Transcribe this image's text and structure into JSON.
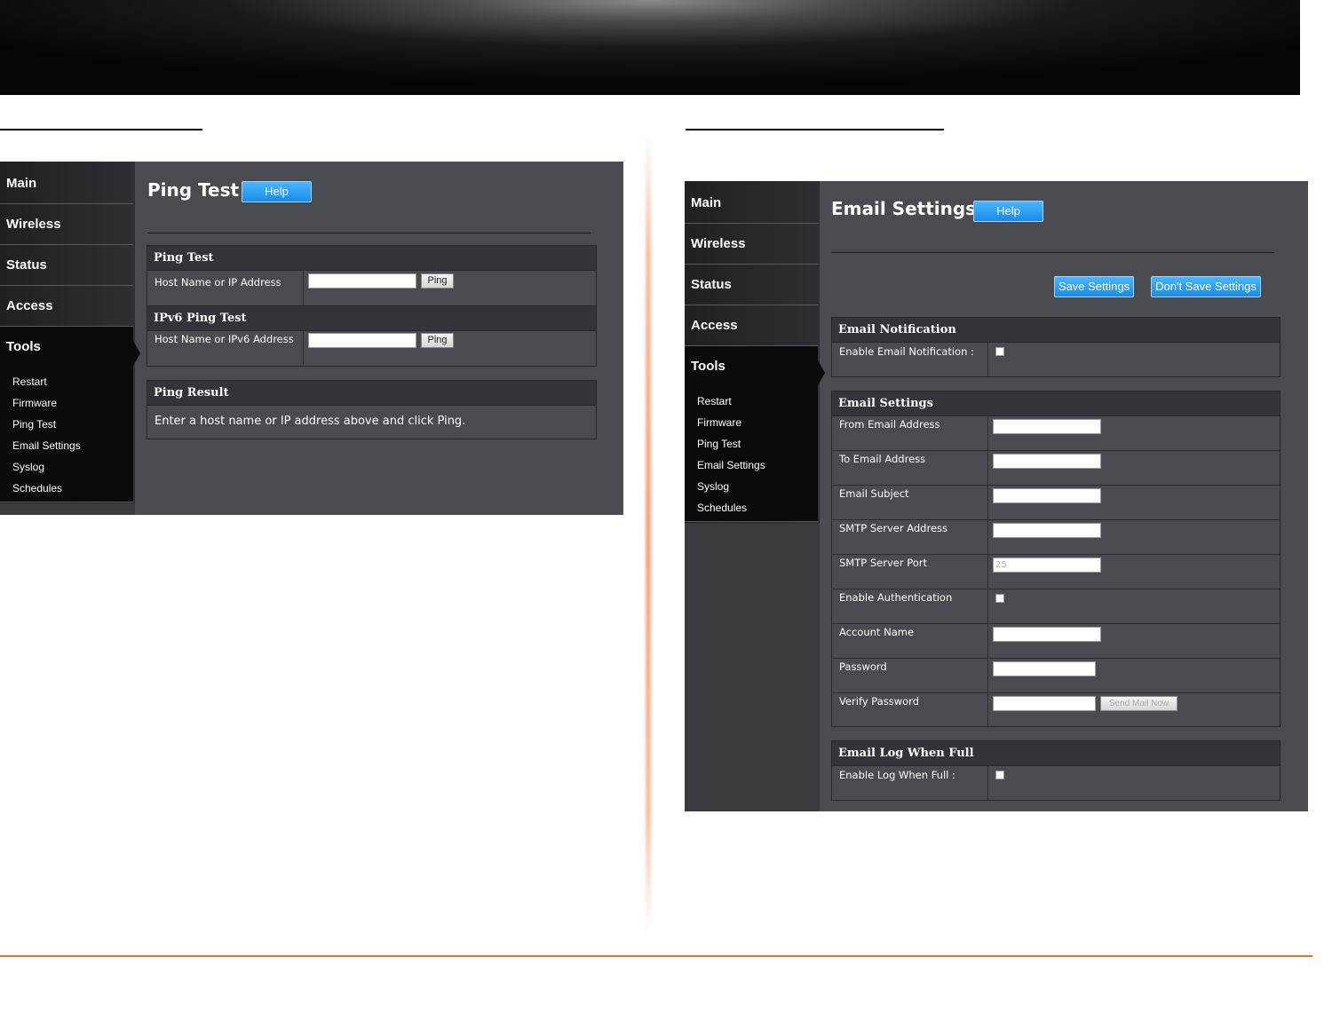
{
  "nav": {
    "main": "Main",
    "wireless": "Wireless",
    "status": "Status",
    "access": "Access",
    "tools": "Tools",
    "tools_items": [
      "Restart",
      "Firmware",
      "Ping Test",
      "Email Settings",
      "Syslog",
      "Schedules"
    ]
  },
  "help_label": "Help",
  "ping": {
    "title": "Ping Test",
    "ping_section": {
      "title": "Ping Test",
      "label": "Host Name or IP Address",
      "value": "",
      "button": "Ping"
    },
    "ipv6_section": {
      "title": "IPv6 Ping Test",
      "label": "Host Name or IPv6 Address",
      "value": "",
      "button": "Ping"
    },
    "result_section": {
      "title": "Ping Result",
      "message": "Enter a host name or IP address above and click Ping."
    }
  },
  "email": {
    "title": "Email Settings",
    "save_button": "Save Settings",
    "dont_save_button": "Don't Save Settings",
    "notification": {
      "title": "Email Notification",
      "label": "Enable Email Notification :",
      "checked": false
    },
    "settings": {
      "title": "Email Settings",
      "from_label": "From Email Address",
      "from_value": "",
      "to_label": "To Email Address",
      "to_value": "",
      "subject_label": "Email Subject",
      "subject_value": "",
      "smtp_address_label": "SMTP Server Address",
      "smtp_address_value": "",
      "smtp_port_label": "SMTP Server Port",
      "smtp_port_value": "25",
      "auth_label": "Enable Authentication",
      "auth_checked": false,
      "account_label": "Account Name",
      "account_value": "",
      "password_label": "Password",
      "password_value": "",
      "verify_label": "Verify Password",
      "verify_value": "",
      "send_mail_button": "Send Mail Now"
    },
    "log": {
      "title": "Email Log When Full",
      "label": "Enable Log When Full :",
      "checked": false
    }
  }
}
